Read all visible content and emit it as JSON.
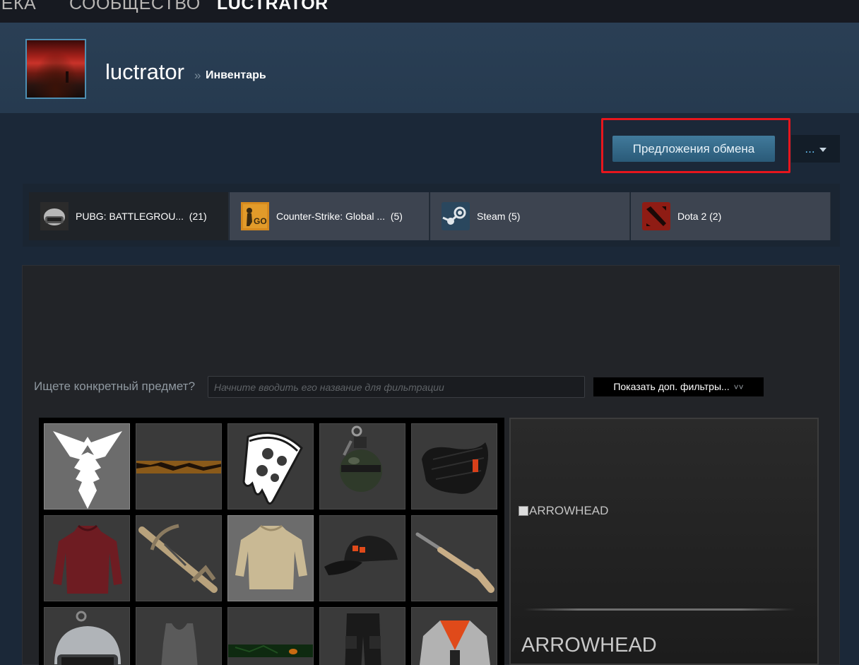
{
  "topnav": {
    "items": [
      {
        "label": "ТЕКА",
        "active": false
      },
      {
        "label": "СООБЩЕСТВО",
        "active": false
      },
      {
        "label": "LUCTRATOR",
        "active": true
      }
    ]
  },
  "profile": {
    "name": "luctrator",
    "separator": "»",
    "page": "Инвентарь"
  },
  "actions": {
    "trade_offers": "Предложения обмена",
    "more": "..."
  },
  "game_tabs": [
    {
      "label": "PUBG: BATTLEGROU...",
      "count": "(21)",
      "icon": "pubg-helmet-icon",
      "active": true
    },
    {
      "label": "Counter-Strike: Global ...",
      "count": "(5)",
      "icon": "csgo-icon",
      "active": false
    },
    {
      "label": "Steam",
      "count": "(5)",
      "icon": "steam-icon",
      "active": false
    },
    {
      "label": "Dota 2",
      "count": "(2)",
      "icon": "dota2-icon",
      "active": false
    }
  ],
  "filter": {
    "label": "Ищете конкретный предмет?",
    "placeholder": "Начните вводить его название для фильтрации",
    "more_filters": "Показать доп. фильтры..."
  },
  "items": [
    {
      "icon": "arrowhead-emblem-icon"
    },
    {
      "icon": "tiger-stripe-banner-icon"
    },
    {
      "icon": "pizza-emblem-icon"
    },
    {
      "icon": "grenade-icon"
    },
    {
      "icon": "face-mask-icon"
    },
    {
      "icon": "red-sweater-icon"
    },
    {
      "icon": "crossbow-icon"
    },
    {
      "icon": "beige-shirt-icon"
    },
    {
      "icon": "baseball-cap-icon"
    },
    {
      "icon": "shotgun-icon"
    },
    {
      "icon": "helmet-icon"
    },
    {
      "icon": "tank-top-icon"
    },
    {
      "icon": "eye-banner-icon"
    },
    {
      "icon": "cargo-pants-icon"
    },
    {
      "icon": "jacket-icon"
    }
  ],
  "detail": {
    "image_alt": "ARROWHEAD",
    "name": "ARROWHEAD"
  },
  "colors": {
    "page_bg": "#1b2838",
    "accent_blue": "#417a9b",
    "highlight_red": "#e6161d"
  }
}
